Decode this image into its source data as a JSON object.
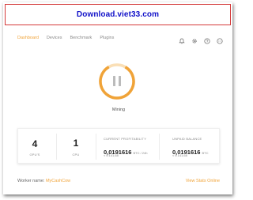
{
  "banner": {
    "text": "Download.viet33.com"
  },
  "tabs": [
    {
      "label": "Dashboard",
      "active": true
    },
    {
      "label": "Devices",
      "active": false
    },
    {
      "label": "Benchmark",
      "active": false
    },
    {
      "label": "Plugins",
      "active": false
    }
  ],
  "toolbar_icons": [
    "bell-icon",
    "settings-icon",
    "help-icon",
    "more-icon"
  ],
  "status": {
    "label": "Mining"
  },
  "stats": {
    "gpus": {
      "value": "4",
      "label": "GPU'S"
    },
    "cpu": {
      "value": "1",
      "label": "CPU"
    },
    "profitability": {
      "label": "CURRENT PROFITABILITY",
      "value": "0,0191616",
      "unit": "BTC / 24h",
      "fiat": "≈ 5.141,68"
    },
    "balance": {
      "label": "UNPAID BALANCE",
      "value": "0,0191616",
      "unit": "BTC",
      "fiat": "≈ 5.141,68"
    }
  },
  "footer": {
    "worker_label": "Worker name:",
    "worker_name": "MyCashCow",
    "link": "View Stats Online"
  },
  "colors": {
    "accent": "#f0a338",
    "banner_text": "#1010c8",
    "banner_border": "#d43a3a"
  }
}
